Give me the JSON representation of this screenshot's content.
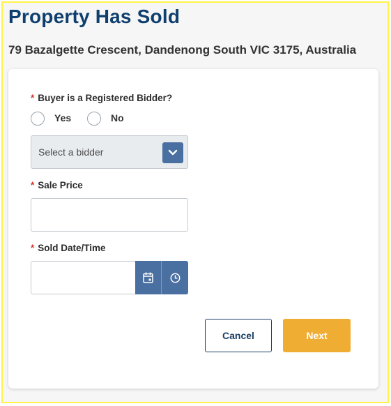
{
  "page": {
    "title": "Property Has Sold",
    "address": "79 Bazalgette Crescent, Dandenong South VIC 3175, Australia"
  },
  "form": {
    "required_marker": "*",
    "buyer_question": "Buyer is a Registered Bidder?",
    "radio_yes": "Yes",
    "radio_no": "No",
    "bidder_select_value": "Select a bidder",
    "sale_price_label": "Sale Price",
    "sale_price_value": "",
    "sold_datetime_label": "Sold Date/Time",
    "sold_datetime_value": ""
  },
  "actions": {
    "cancel_label": "Cancel",
    "next_label": "Next"
  },
  "colors": {
    "title": "#0f3f6e",
    "accent_blue": "#4a6fa1",
    "next_button": "#f0ad34",
    "required": "#d9342b",
    "frame_border": "#fff34a"
  },
  "icons": {
    "select_toggle": "chevron-down-icon",
    "date_picker": "calendar-icon",
    "time_picker": "clock-icon"
  }
}
